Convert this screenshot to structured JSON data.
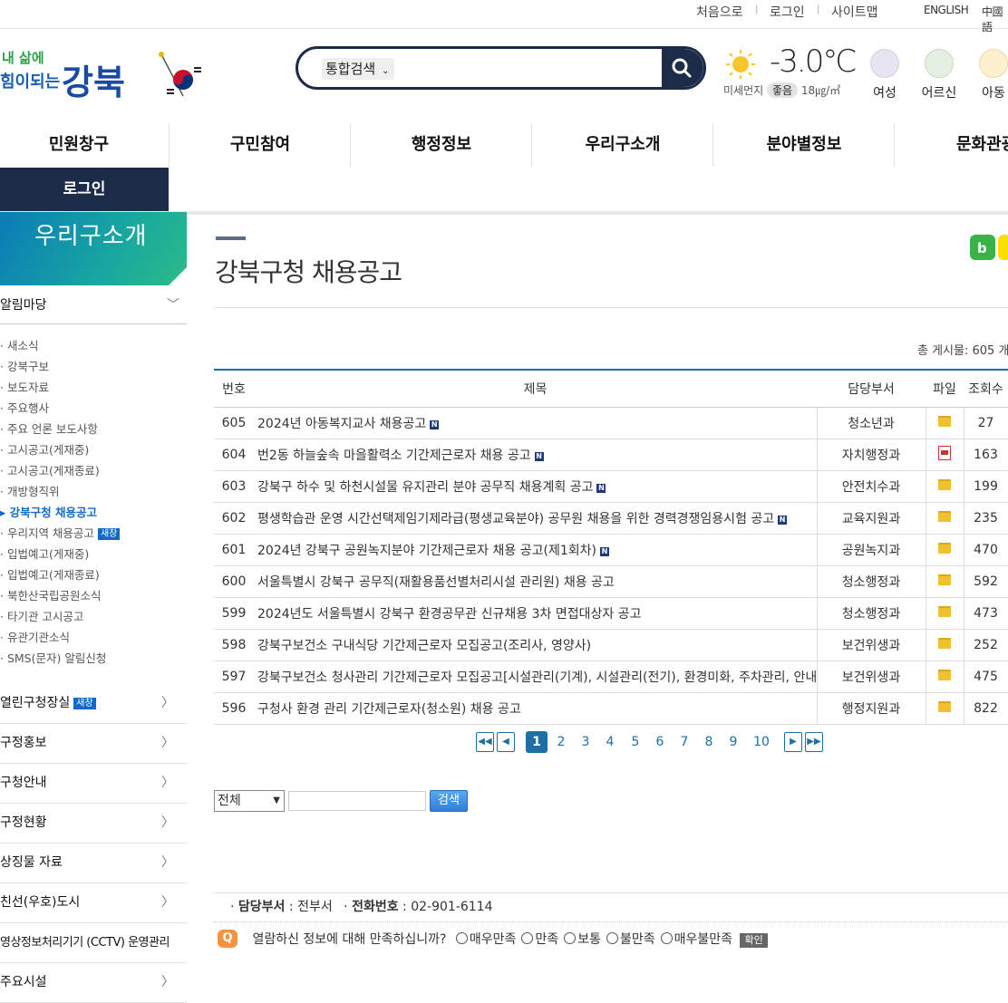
{
  "util": {
    "first": "처음으로",
    "login": "로그인",
    "sitemap": "사이트맵",
    "english": "ENGLISH",
    "chinese": "中國語"
  },
  "logo": {
    "text1": "내 삶에",
    "text2": "힘이되는",
    "text3": "강북"
  },
  "search": {
    "scope": "통합검색",
    "placeholder": ""
  },
  "weather": {
    "temperature": "-3.0℃",
    "dust_label": "미세먼지",
    "dust_status": "좋음",
    "dust_value": "18㎍/㎥"
  },
  "personas": [
    {
      "label": "여성"
    },
    {
      "label": "어르신"
    },
    {
      "label": "아동"
    }
  ],
  "gnb": [
    "민원창구",
    "구민참여",
    "행정정보",
    "우리구소개",
    "분야별정보",
    "문화관광"
  ],
  "login_bar": "로그인",
  "sidebar": {
    "title": "우리구소개",
    "section": "알림마당",
    "subs": [
      "새소식",
      "강북구보",
      "보도자료",
      "주요행사",
      "주요 언론 보도사항",
      "고시공고(게재중)",
      "고시공고(게재종료)",
      "개방형직위",
      "강북구청 채용공고",
      "우리지역 채용공고",
      "입법예고(게재중)",
      "입법예고(게재종료)",
      "북한산국립공원소식",
      "타기관 고시공고",
      "유관기관소식",
      "SMS(문자) 알림신청"
    ],
    "new_badge": "새창",
    "items": [
      "열린구청장실",
      "구정홍보",
      "구청안내",
      "구정현황",
      "상징물 자료",
      "친선(우호)도시",
      "영상정보처리기기 (CCTV) 운영관리",
      "주요시설"
    ]
  },
  "page": {
    "title": "강북구청 채용공고",
    "total_label": "총 게시물:",
    "total_value": "605 개"
  },
  "table": {
    "headers": [
      "번호",
      "제목",
      "담당부서",
      "파일",
      "조회수"
    ],
    "rows": [
      {
        "no": "605",
        "title": "2024년 아동복지교사 채용공고",
        "new": true,
        "dept": "청소년과",
        "file": "folder",
        "views": "27"
      },
      {
        "no": "604",
        "title": "번2동 하늘숲속 마을활력소 기간제근로자 채용 공고",
        "new": true,
        "dept": "자치행정과",
        "file": "pdf",
        "views": "163"
      },
      {
        "no": "603",
        "title": "강북구 하수 및 하천시설물 유지관리 분야 공무직 채용계획 공고",
        "new": true,
        "dept": "안전치수과",
        "file": "folder",
        "views": "199"
      },
      {
        "no": "602",
        "title": "평생학습관 운영 시간선택제임기제라급(평생교육분야) 공무원 채용을 위한 경력경쟁임용시험 공고",
        "new": true,
        "dept": "교육지원과",
        "file": "folder",
        "views": "235"
      },
      {
        "no": "601",
        "title": "2024년 강북구 공원녹지분야 기간제근로자 채용 공고(제1회차)",
        "new": true,
        "dept": "공원녹지과",
        "file": "folder",
        "views": "470"
      },
      {
        "no": "600",
        "title": "서울특별시 강북구 공무직(재활용품선별처리시설 관리원) 채용 공고",
        "new": false,
        "dept": "청소행정과",
        "file": "folder",
        "views": "592"
      },
      {
        "no": "599",
        "title": "2024년도 서울특별시 강북구 환경공무관 신규채용 3차 면접대상자 공고",
        "new": false,
        "dept": "청소행정과",
        "file": "folder",
        "views": "473"
      },
      {
        "no": "598",
        "title": "강북구보건소 구내식당 기간제근로자 모집공고(조리사, 영양사)",
        "new": false,
        "dept": "보건위생과",
        "file": "folder",
        "views": "252"
      },
      {
        "no": "597",
        "title": "강북구보건소 청사관리 기간제근로자 모집공고[시설관리(기계), 시설관리(전기), 환경미화, 주차관리, 안내]",
        "new": false,
        "dept": "보건위생과",
        "file": "folder",
        "views": "475"
      },
      {
        "no": "596",
        "title": "구청사 환경 관리 기간제근로자(청소원) 채용 공고",
        "new": false,
        "dept": "행정지원과",
        "file": "folder",
        "views": "822"
      }
    ]
  },
  "paging": {
    "pages": [
      "1",
      "2",
      "3",
      "4",
      "5",
      "6",
      "7",
      "8",
      "9",
      "10"
    ],
    "current": "1",
    "new_mark": "N"
  },
  "search_form": {
    "select": "전체",
    "button": "검색"
  },
  "footer": {
    "dept_label": "담당부서",
    "dept_value": "전부서",
    "phone_label": "전화번호",
    "phone_value": "02-901-6114",
    "survey_icon": "Q",
    "survey_q": "열람하신 정보에 대해 만족하십니까?",
    "options": [
      "매우만족",
      "만족",
      "보통",
      "불만족",
      "매우불만족"
    ],
    "confirm": "확인"
  }
}
